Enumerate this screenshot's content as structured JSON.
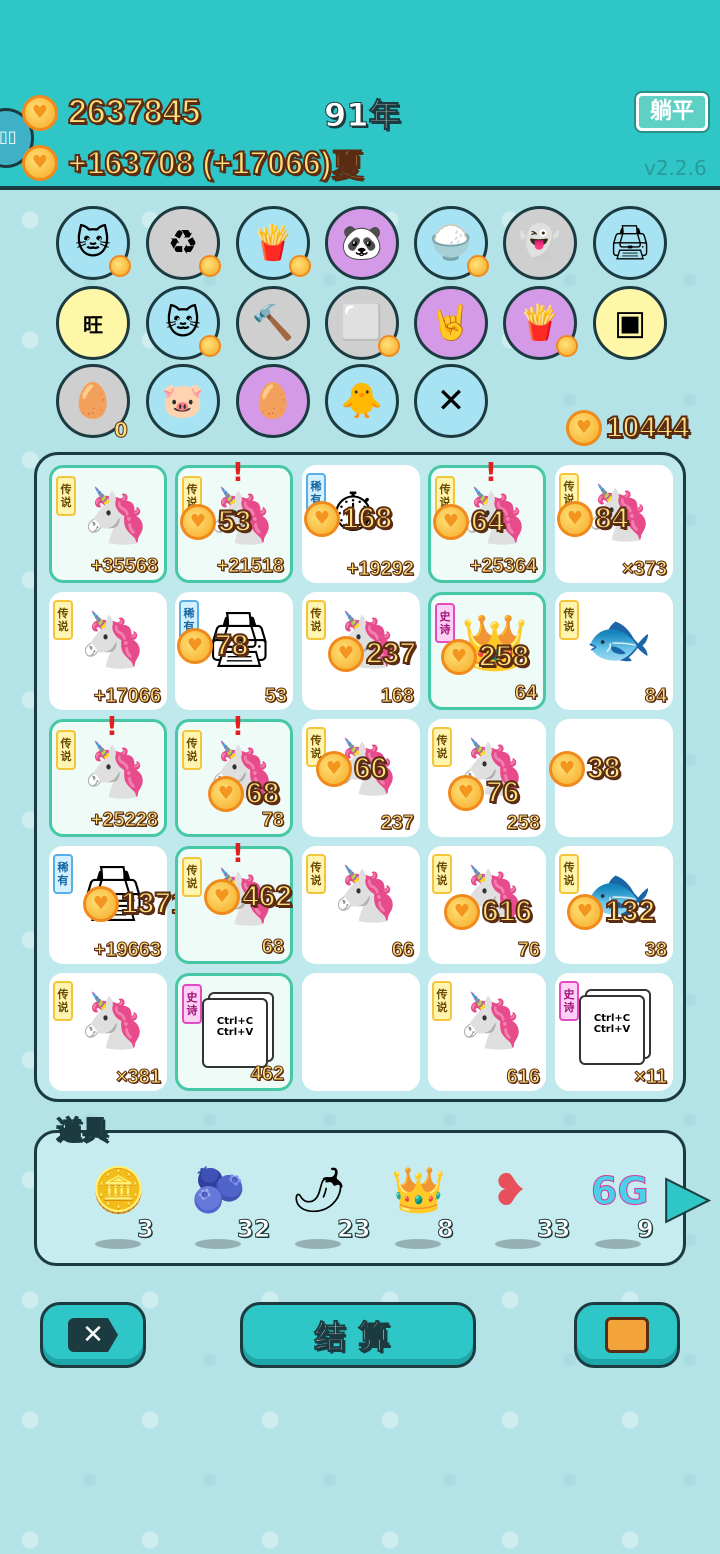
{
  "header": {
    "money": "2637845",
    "income": "+163708 (+17066)",
    "year": "91年",
    "season": "夏",
    "lie_flat_label": "躺平",
    "version": "v2.2.6"
  },
  "owned_items": {
    "row1": [
      "cat-icon",
      "refresh-icon",
      "fries-icon",
      "panda-icon",
      "rice-bowl-icon",
      "ghost-icon",
      "printer-icon"
    ],
    "row2": [
      "wang-icon",
      "cat-icon",
      "hammer-icon",
      "sugar-cubes-icon",
      "rock-hand-icon",
      "fries-icon",
      "cpu-icon"
    ],
    "row3": [
      "egg-tray-icon",
      "piggy-bank-icon",
      "boiled-egg-icon",
      "chick-icon",
      "chopsticks-icon"
    ],
    "egg_tray_count": "0",
    "total_coins": "10444"
  },
  "board": {
    "tiles": [
      {
        "tag": "传说",
        "bottom": "+35568",
        "gain": ""
      },
      {
        "tag": "传说",
        "bottom": "+21518",
        "gain": "53"
      },
      {
        "tag": "稀有",
        "bottom": "+19292",
        "gain": "168"
      },
      {
        "tag": "传说",
        "bottom": "+25364",
        "gain": "64"
      },
      {
        "tag": "传说",
        "bottom": "×373",
        "gain": "84"
      },
      {
        "tag": "传说",
        "bottom": "+17066",
        "gain": ""
      },
      {
        "tag": "稀有",
        "bottom": "53",
        "gain": "78"
      },
      {
        "tag": "传说",
        "bottom": "168",
        "gain": "237"
      },
      {
        "tag": "史诗",
        "bottom": "64",
        "gain": "258"
      },
      {
        "tag": "传说",
        "bottom": "84",
        "gain": ""
      },
      {
        "tag": "传说",
        "bottom": "+25228",
        "gain": ""
      },
      {
        "tag": "传说",
        "bottom": "78",
        "gain": "68"
      },
      {
        "tag": "传说",
        "bottom": "237",
        "gain": "66"
      },
      {
        "tag": "传说",
        "bottom": "258",
        "gain": "76"
      },
      {
        "tag": "",
        "bottom": "",
        "gain": "38"
      },
      {
        "tag": "稀有",
        "bottom": "+19663",
        "gain": "1371"
      },
      {
        "tag": "传说",
        "bottom": "68",
        "gain": "462"
      },
      {
        "tag": "传说",
        "bottom": "66",
        "gain": ""
      },
      {
        "tag": "传说",
        "bottom": "76",
        "gain": "616"
      },
      {
        "tag": "传说",
        "bottom": "38",
        "gain": "132"
      },
      {
        "tag": "传说",
        "bottom": "×381",
        "gain": ""
      },
      {
        "tag": "史诗",
        "bottom": "462",
        "gain": ""
      },
      {
        "tag": "",
        "bottom": "",
        "gain": ""
      },
      {
        "tag": "传说",
        "bottom": "616",
        "gain": ""
      },
      {
        "tag": "史诗",
        "bottom": "×11",
        "gain": ""
      }
    ],
    "copy_card_text": "Ctrl+C Ctrl+V"
  },
  "props": {
    "title": "道具",
    "items": [
      {
        "icon": "dollar-coin-icon",
        "count": "3"
      },
      {
        "icon": "blueberry-icon",
        "count": "32"
      },
      {
        "icon": "chili-icon",
        "count": "23"
      },
      {
        "icon": "crown-icon",
        "count": "8"
      },
      {
        "icon": "liver-icon",
        "count": "33"
      },
      {
        "icon": "6g-icon",
        "count": "9",
        "label": "6G"
      }
    ]
  },
  "buttons": {
    "settle_label": "结算"
  }
}
